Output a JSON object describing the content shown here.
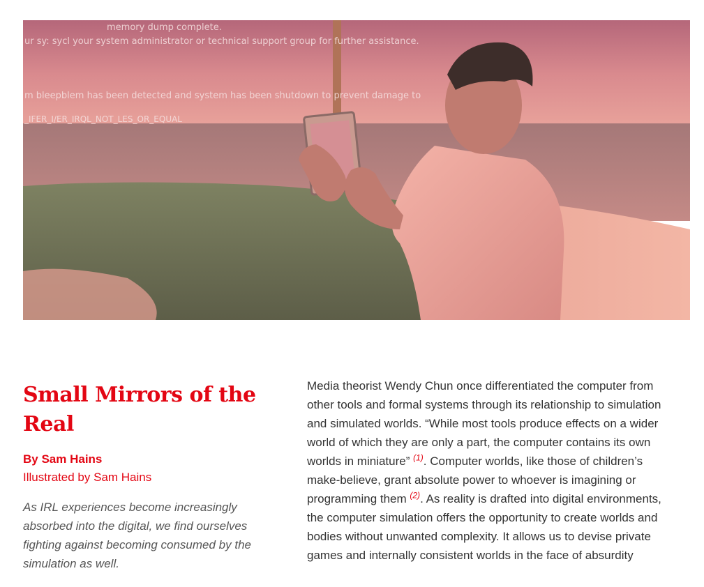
{
  "hero": {
    "overlay_lines": [
      "memory dump complete.",
      "ur sy: sycl your system administrator or technical support group for further assistance.",
      "m bleepblem has been detected and system has been shutdown to prevent damage to",
      "_IFER_I/ER_IRQL_NOT_LES_OR_EQUAL"
    ]
  },
  "article": {
    "title": "Small Mirrors of the Real",
    "byline": "By Sam Hains",
    "illustrated_by": "Illustrated by Sam Hains",
    "dek": "As IRL experiences become increasingly absorbed into the digital, we find ourselves fighting against becoming consumed by the simulation as well.",
    "body_part1": "Media theorist Wendy Chun once differentiated the computer from other tools and formal systems through its relationship to simulation and simulated worlds. “While most tools produce effects on a wider world of which they are only a part, the computer contains its own worlds in miniature” ",
    "footnote1": "(1)",
    "body_part2": ". Computer worlds, like those of children’s make-believe, grant absolute power to whoever is imagining or programming them ",
    "footnote2": "(2)",
    "body_part3": ". As reality is drafted into digital environments, the computer simulation offers the opportunity to create worlds and bodies without unwanted complexity. It allows us to devise private games and internally consistent worlds in the face of absurdity"
  }
}
